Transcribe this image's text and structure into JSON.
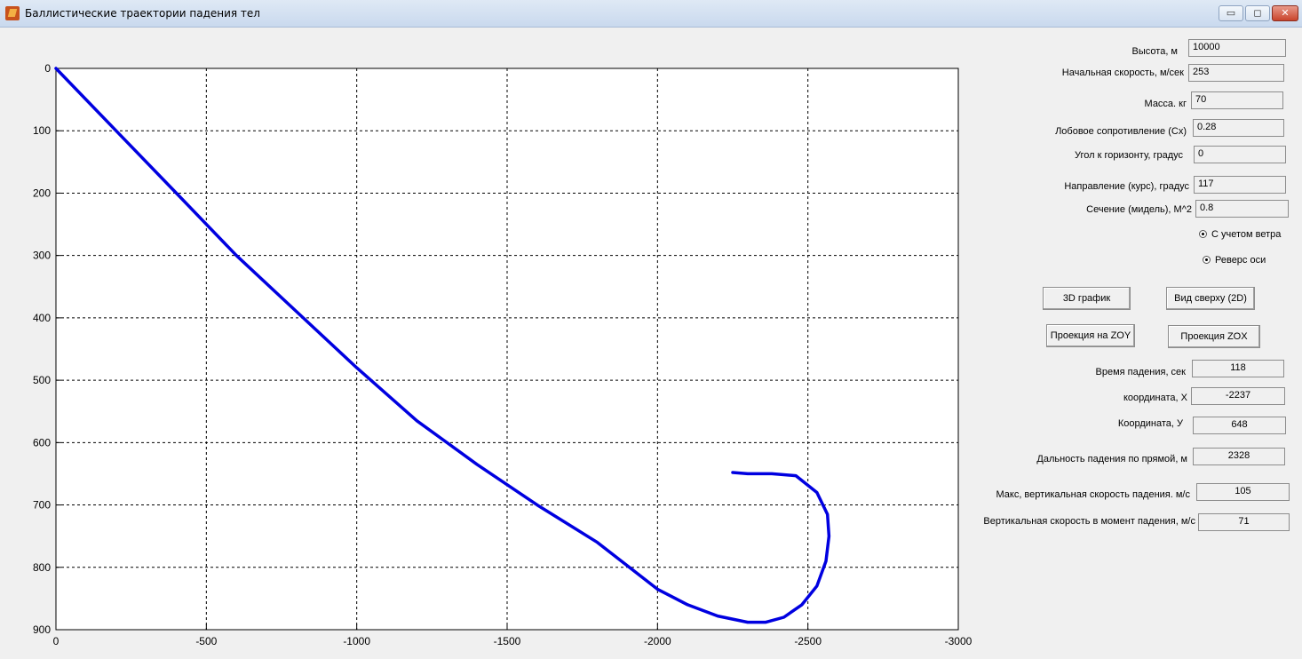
{
  "window": {
    "title": "Баллистические траектории падения тел",
    "minimize_symbol": "▭",
    "maximize_symbol": "◻",
    "close_symbol": "✕"
  },
  "inputs": [
    {
      "label": "Высота, м",
      "value": "10000"
    },
    {
      "label": "Начальная скорость, м/сек",
      "value": "253"
    },
    {
      "label": "Масса. кг",
      "value": "70"
    },
    {
      "label": "Лобовое сопротивление (Cx)",
      "value": "0.28"
    },
    {
      "label": "Угол к горизонту, градус",
      "value": "0"
    },
    {
      "label": "Направление  (курс), градус",
      "value": "117"
    },
    {
      "label": "Сечение (мидель), М^2",
      "value": "0.8"
    }
  ],
  "options": [
    {
      "label": "С учетом ветра",
      "selected": true
    },
    {
      "label": "Реверс оси",
      "selected": true
    }
  ],
  "buttons": {
    "plot3d": "3D график",
    "top_view": "Вид сверху (2D)",
    "proj_zoy": "Проекция на ZOY",
    "proj_zox": "Проекция ZOX"
  },
  "results": [
    {
      "label": "Время падения, сек",
      "value": "118"
    },
    {
      "label": "координата, X",
      "value": "-2237"
    },
    {
      "label": "Координата, У",
      "value": "648"
    },
    {
      "label": "Дальность падения по прямой, м",
      "value": "2328"
    },
    {
      "label": "Макс,  вертикальная скорость падения. м/с",
      "value": "105"
    },
    {
      "label": "Вертикальная  скорость в момент падения, м/с",
      "value": "71"
    }
  ],
  "chart_data": {
    "type": "line",
    "title": "",
    "xlabel": "",
    "ylabel": "",
    "xlim": [
      0,
      -3000
    ],
    "ylim": [
      0,
      900
    ],
    "x_reversed": true,
    "y_reversed": true,
    "grid": true,
    "x_ticks": [
      "0",
      "-500",
      "-1000",
      "-1500",
      "-2000",
      "-2500",
      "-3000"
    ],
    "y_ticks": [
      "0",
      "100",
      "200",
      "300",
      "400",
      "500",
      "600",
      "700",
      "800",
      "900"
    ],
    "series": [
      {
        "color": "#0000e0",
        "points": [
          [
            0,
            0
          ],
          [
            -200,
            100
          ],
          [
            -400,
            200
          ],
          [
            -600,
            300
          ],
          [
            -800,
            390
          ],
          [
            -1000,
            480
          ],
          [
            -1200,
            565
          ],
          [
            -1400,
            635
          ],
          [
            -1600,
            700
          ],
          [
            -1800,
            760
          ],
          [
            -2000,
            835
          ],
          [
            -2100,
            860
          ],
          [
            -2200,
            878
          ],
          [
            -2300,
            888
          ],
          [
            -2360,
            888
          ],
          [
            -2420,
            880
          ],
          [
            -2480,
            860
          ],
          [
            -2530,
            830
          ],
          [
            -2560,
            790
          ],
          [
            -2570,
            750
          ],
          [
            -2565,
            715
          ],
          [
            -2530,
            680
          ],
          [
            -2460,
            653
          ],
          [
            -2380,
            650
          ],
          [
            -2300,
            650
          ],
          [
            -2250,
            648
          ]
        ]
      }
    ]
  }
}
